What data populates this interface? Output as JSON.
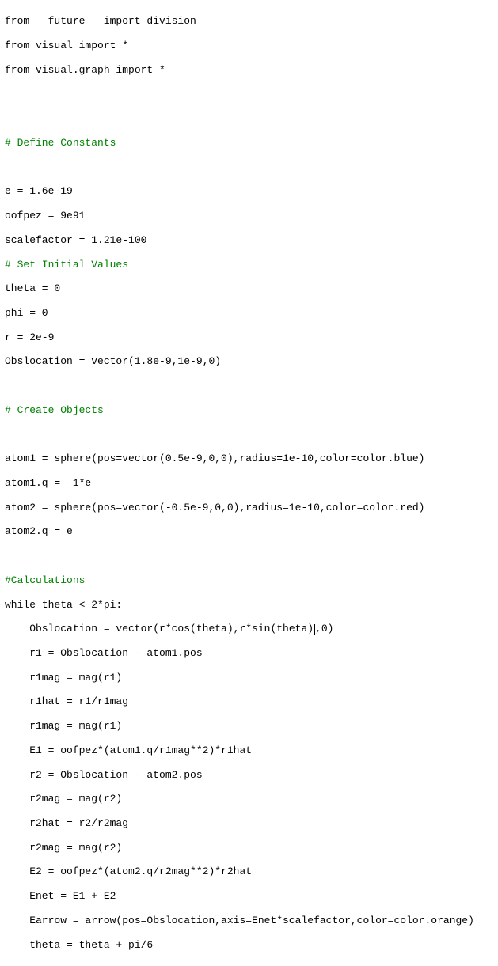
{
  "code": {
    "lines": [
      {
        "text": "from __future__ import division",
        "type": "normal"
      },
      {
        "text": "from visual import *",
        "type": "normal"
      },
      {
        "text": "from visual.graph import *",
        "type": "normal"
      },
      {
        "text": "",
        "type": "normal"
      },
      {
        "text": "",
        "type": "normal"
      },
      {
        "text": "# Define Constants",
        "type": "comment"
      },
      {
        "text": "",
        "type": "normal"
      },
      {
        "text": "e = 1.6e-19",
        "type": "normal"
      },
      {
        "text": "oofpez = 9e91",
        "type": "normal"
      },
      {
        "text": "scalefactor = 1.21e-100",
        "type": "normal"
      },
      {
        "text": "# Set Initial Values",
        "type": "comment"
      },
      {
        "text": "theta = 0",
        "type": "normal"
      },
      {
        "text": "phi = 0",
        "type": "normal"
      },
      {
        "text": "r = 2e-9",
        "type": "normal"
      },
      {
        "text": "Obslocation = vector(1.8e-9,1e-9,0)",
        "type": "normal"
      },
      {
        "text": "",
        "type": "normal"
      },
      {
        "text": "# Create Objects",
        "type": "comment"
      },
      {
        "text": "",
        "type": "normal"
      },
      {
        "text": "atom1 = sphere(pos=vector(0.5e-9,0,0),radius=1e-10,color=color.blue)",
        "type": "normal"
      },
      {
        "text": "atom1.q = -1*e",
        "type": "normal"
      },
      {
        "text": "atom2 = sphere(pos=vector(-0.5e-9,0,0),radius=1e-10,color=color.red)",
        "type": "normal"
      },
      {
        "text": "atom2.q = e",
        "type": "normal"
      },
      {
        "text": "",
        "type": "normal"
      },
      {
        "text": "#Calculations",
        "type": "comment"
      },
      {
        "text": "while theta < 2*pi:",
        "type": "normal"
      },
      {
        "text": "    Obslocation = vector(r*cos(theta),r*sin(theta),0)",
        "type": "normal",
        "cursor": true
      },
      {
        "text": "    r1 = Obslocation - atom1.pos",
        "type": "normal"
      },
      {
        "text": "    r1mag = mag(r1)",
        "type": "normal"
      },
      {
        "text": "    r1hat = r1/r1mag",
        "type": "normal"
      },
      {
        "text": "    r1mag = mag(r1)",
        "type": "normal"
      },
      {
        "text": "    E1 = oofpez*(atom1.q/r1mag**2)*r1hat",
        "type": "normal"
      },
      {
        "text": "    r2 = Obslocation - atom2.pos",
        "type": "normal"
      },
      {
        "text": "    r2mag = mag(r2)",
        "type": "normal"
      },
      {
        "text": "    r2hat = r2/r2mag",
        "type": "normal"
      },
      {
        "text": "    r2mag = mag(r2)",
        "type": "normal"
      },
      {
        "text": "    E2 = oofpez*(atom2.q/r2mag**2)*r2hat",
        "type": "normal"
      },
      {
        "text": "    Enet = E1 + E2",
        "type": "normal"
      },
      {
        "text": "    Earrow = arrow(pos=Obslocation,axis=Enet*scalefactor,color=color.orange)",
        "type": "normal"
      },
      {
        "text": "    theta = theta + pi/6",
        "type": "normal"
      }
    ]
  }
}
